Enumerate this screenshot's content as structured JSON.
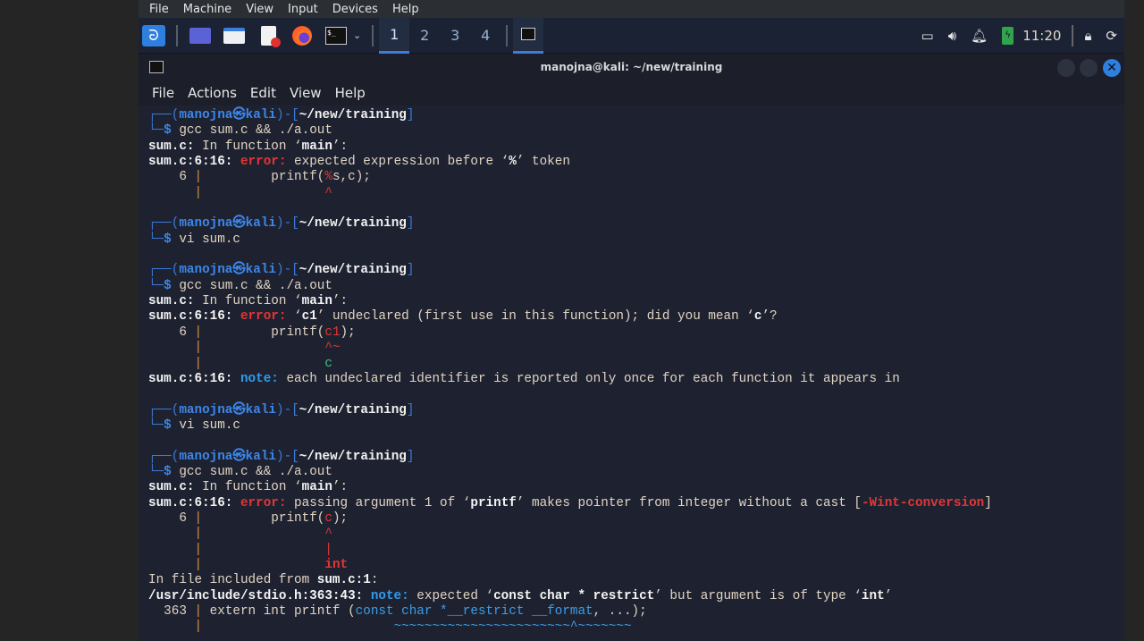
{
  "vm_menu": [
    "File",
    "Machine",
    "View",
    "Input",
    "Devices",
    "Help"
  ],
  "taskbar": {
    "workspaces": [
      "1",
      "2",
      "3",
      "4"
    ],
    "active_workspace": "1",
    "clock": "11:20",
    "icons": [
      "kali-menu-icon",
      "desktop-icon",
      "file-manager-icon",
      "text-editor-icon",
      "firefox-icon",
      "terminal-icon",
      "chevron-down-icon",
      "terminal-window-icon",
      "display-icon",
      "volume-icon",
      "bell-icon",
      "battery-icon",
      "lock-icon",
      "logout-icon"
    ]
  },
  "window": {
    "title": "manojna@kali: ~/new/training",
    "menu": [
      "File",
      "Actions",
      "Edit",
      "View",
      "Help"
    ]
  },
  "colors": {
    "accent": "#3b7ddd",
    "error": "#e23535",
    "note": "#2f9bf0",
    "background": "#1e2230"
  },
  "terminal": {
    "lines": [
      [
        [
          "┌──(",
          "fr"
        ],
        [
          "manojna㉿kali",
          "pu"
        ],
        [
          ")-[",
          "fr"
        ],
        [
          "~/new/training",
          "pa"
        ],
        [
          "]",
          "fr"
        ]
      ],
      [
        [
          "└─",
          "fr"
        ],
        [
          "$ ",
          "pu"
        ],
        [
          "gcc sum.c && ./a.out",
          ""
        ]
      ],
      [
        [
          "sum.c:",
          "b"
        ],
        [
          " In function ‘",
          ""
        ],
        [
          "main",
          "b"
        ],
        [
          "’:",
          ""
        ]
      ],
      [
        [
          "sum.c:6:16: ",
          "b"
        ],
        [
          "error:",
          "er"
        ],
        [
          " expected expression before ‘",
          ""
        ],
        [
          "%",
          "b"
        ],
        [
          "’ token",
          ""
        ]
      ],
      [
        [
          "    6 ",
          ""
        ],
        [
          "|",
          "pi"
        ],
        [
          "         printf(",
          ""
        ],
        [
          "%",
          "rd"
        ],
        [
          "s,c);",
          ""
        ]
      ],
      [
        [
          "      ",
          ""
        ],
        [
          "|",
          "pi"
        ],
        [
          "                ",
          ""
        ],
        [
          "^",
          "rd"
        ]
      ],
      [],
      [
        [
          "┌──(",
          "fr"
        ],
        [
          "manojna㉿kali",
          "pu"
        ],
        [
          ")-[",
          "fr"
        ],
        [
          "~/new/training",
          "pa"
        ],
        [
          "]",
          "fr"
        ]
      ],
      [
        [
          "└─",
          "fr"
        ],
        [
          "$ ",
          "pu"
        ],
        [
          "vi sum.c",
          ""
        ]
      ],
      [],
      [
        [
          "┌──(",
          "fr"
        ],
        [
          "manojna㉿kali",
          "pu"
        ],
        [
          ")-[",
          "fr"
        ],
        [
          "~/new/training",
          "pa"
        ],
        [
          "]",
          "fr"
        ]
      ],
      [
        [
          "└─",
          "fr"
        ],
        [
          "$ ",
          "pu"
        ],
        [
          "gcc sum.c && ./a.out",
          ""
        ]
      ],
      [
        [
          "sum.c:",
          "b"
        ],
        [
          " In function ‘",
          ""
        ],
        [
          "main",
          "b"
        ],
        [
          "’:",
          ""
        ]
      ],
      [
        [
          "sum.c:6:16: ",
          "b"
        ],
        [
          "error:",
          "er"
        ],
        [
          " ‘",
          ""
        ],
        [
          "c1",
          "b"
        ],
        [
          "’ undeclared (first use in this function); did you mean ‘",
          ""
        ],
        [
          "c",
          "b"
        ],
        [
          "’?",
          ""
        ]
      ],
      [
        [
          "    6 ",
          ""
        ],
        [
          "|",
          "pi"
        ],
        [
          "         printf(",
          ""
        ],
        [
          "c1",
          "rd"
        ],
        [
          ");",
          ""
        ]
      ],
      [
        [
          "      ",
          ""
        ],
        [
          "|",
          "pi"
        ],
        [
          "                ",
          ""
        ],
        [
          "^~",
          "rd"
        ]
      ],
      [
        [
          "      ",
          ""
        ],
        [
          "|",
          "pi"
        ],
        [
          "                ",
          ""
        ],
        [
          "c",
          "gn"
        ]
      ],
      [
        [
          "sum.c:6:16: ",
          "b"
        ],
        [
          "note:",
          "nt"
        ],
        [
          " each undeclared identifier is reported only once for each function it appears in",
          ""
        ]
      ],
      [],
      [
        [
          "┌──(",
          "fr"
        ],
        [
          "manojna㉿kali",
          "pu"
        ],
        [
          ")-[",
          "fr"
        ],
        [
          "~/new/training",
          "pa"
        ],
        [
          "]",
          "fr"
        ]
      ],
      [
        [
          "└─",
          "fr"
        ],
        [
          "$ ",
          "pu"
        ],
        [
          "vi sum.c",
          ""
        ]
      ],
      [],
      [
        [
          "┌──(",
          "fr"
        ],
        [
          "manojna㉿kali",
          "pu"
        ],
        [
          ")-[",
          "fr"
        ],
        [
          "~/new/training",
          "pa"
        ],
        [
          "]",
          "fr"
        ]
      ],
      [
        [
          "└─",
          "fr"
        ],
        [
          "$ ",
          "pu"
        ],
        [
          "gcc sum.c && ./a.out",
          ""
        ]
      ],
      [
        [
          "sum.c:",
          "b"
        ],
        [
          " In function ‘",
          ""
        ],
        [
          "main",
          "b"
        ],
        [
          "’:",
          ""
        ]
      ],
      [
        [
          "sum.c:6:16: ",
          "b"
        ],
        [
          "error:",
          "er"
        ],
        [
          " passing argument 1 of ‘",
          ""
        ],
        [
          "printf",
          "b"
        ],
        [
          "’ makes pointer from integer without a cast [",
          ""
        ],
        [
          "-Wint-conversion",
          "rdb"
        ],
        [
          "]",
          ""
        ]
      ],
      [
        [
          "    6 ",
          ""
        ],
        [
          "|",
          "pi"
        ],
        [
          "         printf(",
          ""
        ],
        [
          "c",
          "rd"
        ],
        [
          ");",
          ""
        ]
      ],
      [
        [
          "      ",
          ""
        ],
        [
          "|",
          "pi"
        ],
        [
          "                ",
          ""
        ],
        [
          "^",
          "rd"
        ]
      ],
      [
        [
          "      ",
          ""
        ],
        [
          "|",
          "pi"
        ],
        [
          "                ",
          ""
        ],
        [
          "|",
          "rd"
        ]
      ],
      [
        [
          "      ",
          ""
        ],
        [
          "|",
          "pi"
        ],
        [
          "                ",
          ""
        ],
        [
          "int",
          "rdb"
        ]
      ],
      [
        [
          "In file included from ",
          ""
        ],
        [
          "sum.c:1",
          "b"
        ],
        [
          ":",
          ""
        ]
      ],
      [
        [
          "/usr/include/stdio.h:363:43: ",
          "b"
        ],
        [
          "note:",
          "nt"
        ],
        [
          " expected ‘",
          ""
        ],
        [
          "const char * restrict",
          "b"
        ],
        [
          "’ but argument is of type ‘",
          ""
        ],
        [
          "int",
          "b"
        ],
        [
          "’",
          ""
        ]
      ],
      [
        [
          "  363 ",
          ""
        ],
        [
          "|",
          "pi"
        ],
        [
          " extern int printf (",
          ""
        ],
        [
          "const char *__restrict __format",
          "cy"
        ],
        [
          ", ...);",
          ""
        ]
      ],
      [
        [
          "      ",
          ""
        ],
        [
          "|",
          "pi"
        ],
        [
          "                         ",
          ""
        ],
        [
          "~~~~~~~~~~~~~~~~~~~~~~~^~~~~~~~",
          "cy"
        ]
      ]
    ]
  }
}
